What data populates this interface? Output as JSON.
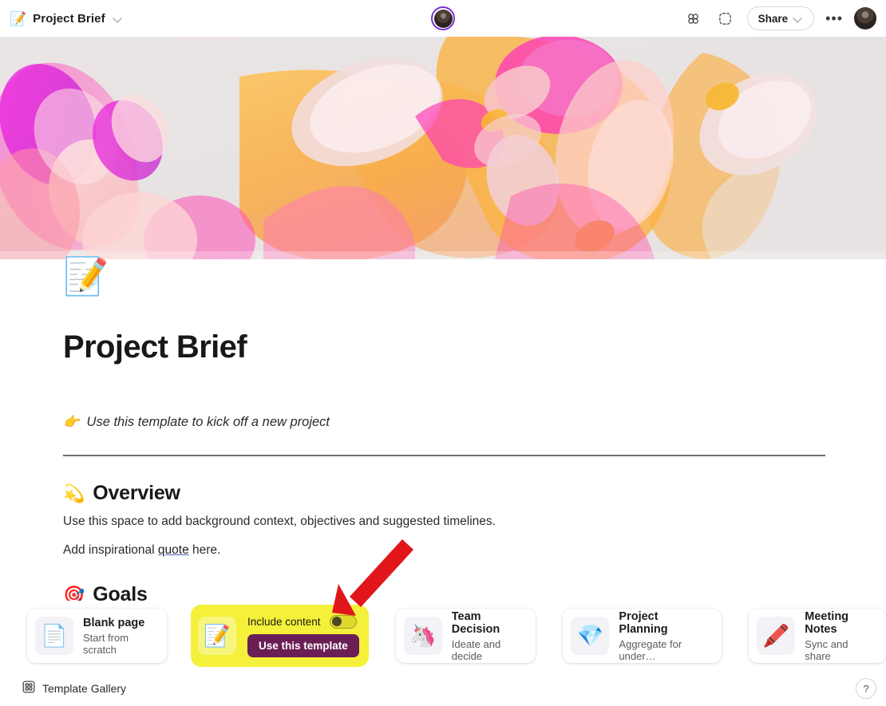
{
  "titlebar": {
    "doc_icon": "📝",
    "doc_title": "Project Brief",
    "chevron_icon": "chevron-down-icon",
    "apps_icon": "apps-grid-icon",
    "capture_icon": "dashed-selection-icon",
    "share_label": "Share",
    "more_label": "•••",
    "avatar_label": "user-avatar"
  },
  "page": {
    "emoji": "📝",
    "title": "Project Brief",
    "subtitle_emoji": "👉",
    "subtitle": "Use this template to kick off a new project",
    "sections": [
      {
        "emoji": "💫",
        "heading": "Overview",
        "paragraph_1": "Use this space to add background context, objectives and suggested timelines.",
        "paragraph_2_before": "Add inspirational ",
        "paragraph_2_link": "quote",
        "paragraph_2_after": " here."
      },
      {
        "emoji": "🎯",
        "heading": "Goals"
      }
    ]
  },
  "template_bar": {
    "cards": [
      {
        "emoji": "📄",
        "title": "Blank page",
        "subtitle": "Start from scratch"
      },
      {
        "emoji": "🦄",
        "title": "Team Decision",
        "subtitle": "Ideate and decide"
      },
      {
        "emoji": "💎",
        "title": "Project Planning",
        "subtitle": "Aggregate for under…"
      },
      {
        "emoji": "🖍️",
        "title": "Meeting Notes",
        "subtitle": "Sync and share"
      }
    ],
    "highlighted": {
      "emoji": "📝",
      "toggle_label": "Include content",
      "toggle_state": "off",
      "button_label": "Use this template",
      "highlight_color": "#f5f03a",
      "button_color": "#6b1e55"
    }
  },
  "footer": {
    "gallery_icon": "grid-gallery-icon",
    "gallery_label": "Template Gallery",
    "help_label": "?"
  },
  "annotation": {
    "arrow_color": "#e1161b",
    "points_at": "include-content-toggle"
  }
}
